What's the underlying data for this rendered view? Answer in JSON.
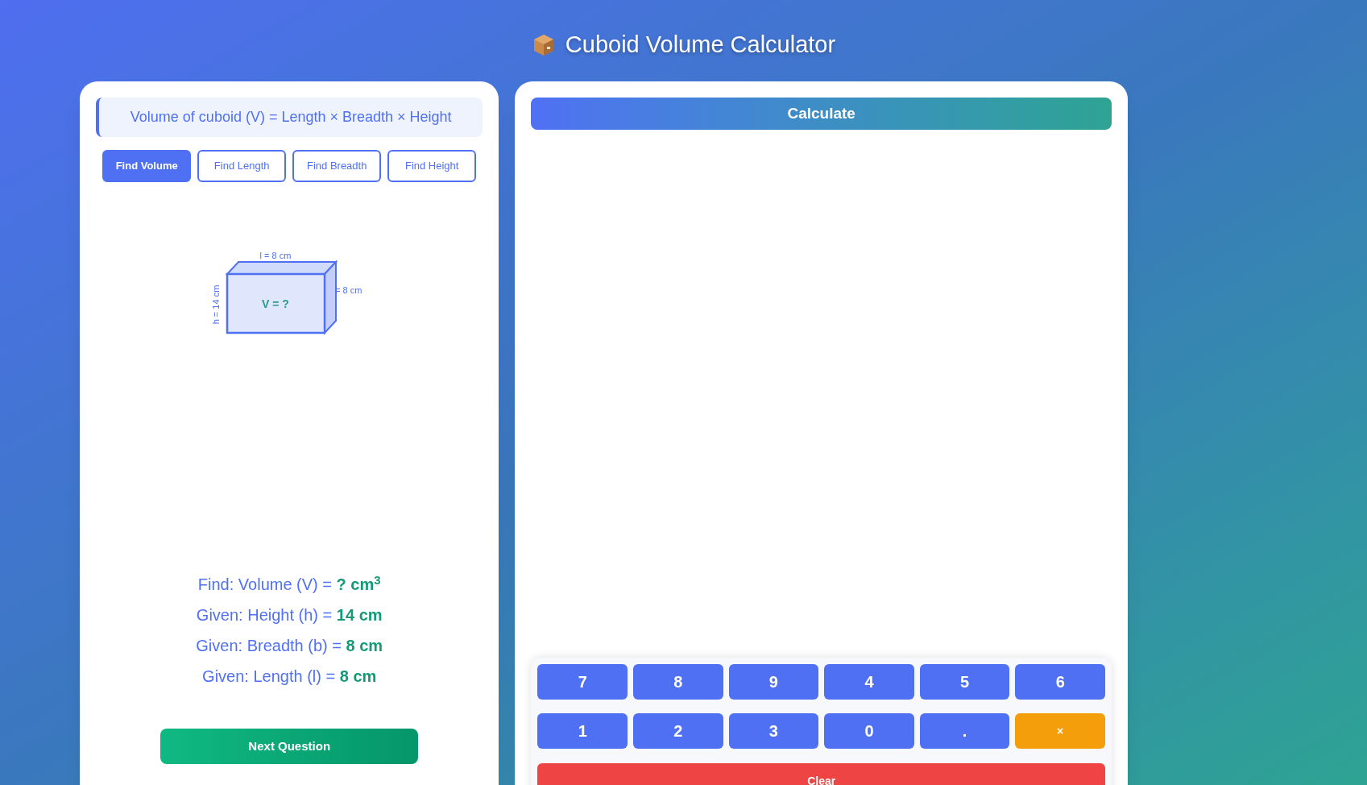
{
  "title": "Cuboid Volume Calculator",
  "formula": "Volume of cuboid (V) = Length × Breadth × Height",
  "modes": [
    {
      "label": "Find Volume",
      "selected": true
    },
    {
      "label": "Find Length",
      "selected": false
    },
    {
      "label": "Find Breadth",
      "selected": false
    },
    {
      "label": "Find Height",
      "selected": false
    }
  ],
  "diagram": {
    "length_label": "l = 8 cm",
    "breadth_label": "= 8 cm",
    "height_label": "h = 14 cm",
    "center_label": "V = ?"
  },
  "problem": [
    {
      "label": "Find: Volume (V) =",
      "value": "? cm$^{3}$"
    },
    {
      "label": "Given: Height (h) =",
      "value": "14 cm"
    },
    {
      "label": "Given: Breadth (b) =",
      "value": "8 cm"
    },
    {
      "label": "Given: Length (l) =",
      "value": "8 cm"
    }
  ],
  "next_button": "Next Question",
  "calculate_button": "Calculate",
  "keypad": [
    {
      "label": "7",
      "kind": "digit"
    },
    {
      "label": "8",
      "kind": "digit"
    },
    {
      "label": "9",
      "kind": "digit"
    },
    {
      "label": "4",
      "kind": "digit"
    },
    {
      "label": "5",
      "kind": "digit"
    },
    {
      "label": "6",
      "kind": "digit"
    },
    {
      "label": "1",
      "kind": "digit"
    },
    {
      "label": "2",
      "kind": "digit"
    },
    {
      "label": "3",
      "kind": "digit"
    },
    {
      "label": "0",
      "kind": "digit"
    },
    {
      "label": ".",
      "kind": "digit"
    },
    {
      "label": "×",
      "kind": "operator"
    },
    {
      "label": "Clear",
      "kind": "clear"
    }
  ]
}
